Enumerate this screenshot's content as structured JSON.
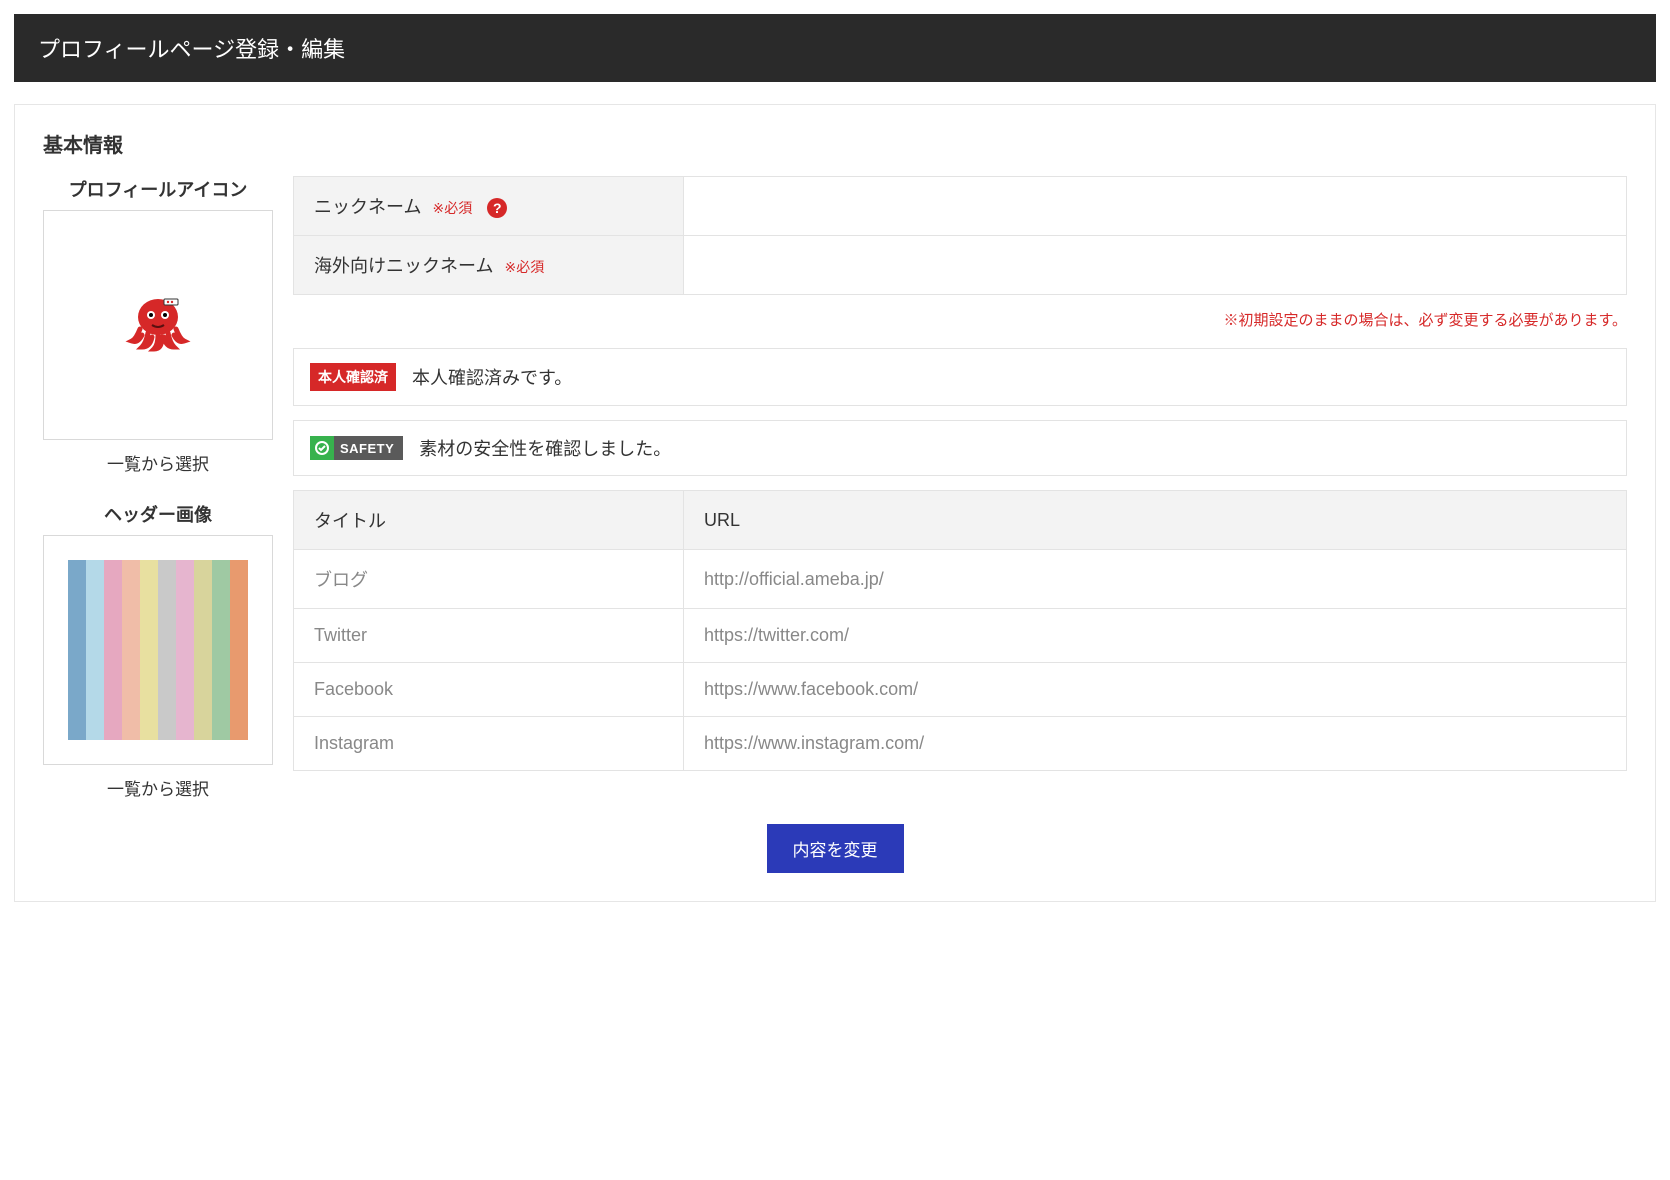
{
  "header": {
    "title": "プロフィールページ登録・編集"
  },
  "section": {
    "title": "基本情報"
  },
  "left": {
    "icon_label": "プロフィールアイコン",
    "icon_select": "一覧から選択",
    "header_label": "ヘッダー画像",
    "header_select": "一覧から選択"
  },
  "form": {
    "nickname_label": "ニックネーム",
    "nickname_req": "※必須",
    "nickname_value": "",
    "intl_nickname_label": "海外向けニックネーム",
    "intl_nickname_req": "※必須",
    "intl_nickname_value": "",
    "warning": "※初期設定のままの場合は、必ず変更する必要があります。"
  },
  "status": {
    "verified_badge": "本人確認済",
    "verified_text": "本人確認済みです。",
    "safety_badge": "SAFETY",
    "safety_text": "素材の安全性を確認しました。"
  },
  "links": {
    "header_title": "タイトル",
    "header_url": "URL",
    "rows": [
      {
        "title": "ブログ",
        "url": "http://official.ameba.jp/"
      },
      {
        "title": "Twitter",
        "url": "https://twitter.com/"
      },
      {
        "title": "Facebook",
        "url": "https://www.facebook.com/"
      },
      {
        "title": "Instagram",
        "url": "https://www.instagram.com/"
      }
    ]
  },
  "submit": {
    "label": "内容を変更"
  },
  "colors": {
    "chalk": [
      "#7aa8c9",
      "#b4d9e8",
      "#e6a8c0",
      "#f0bda8",
      "#e8e0a0",
      "#c9c9c9",
      "#e6b5cf",
      "#d8d49c",
      "#9fc9a3",
      "#e89a6e"
    ]
  }
}
